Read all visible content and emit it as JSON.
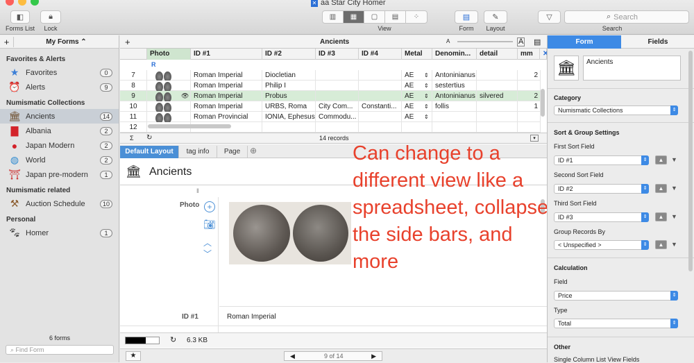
{
  "window": {
    "title": "aa Star City Homer"
  },
  "toolbar": {
    "forms_list": "Forms List",
    "lock": "Lock",
    "view": "View",
    "form": "Form",
    "layout": "Layout",
    "search_label": "Search",
    "search_placeholder": "Search"
  },
  "sidebar": {
    "header": "My Forms",
    "add": "+",
    "sections": [
      {
        "title": "Favorites & Alerts",
        "items": [
          {
            "label": "Favorites",
            "count": "0",
            "icon": "star-icon"
          },
          {
            "label": "Alerts",
            "count": "9",
            "icon": "alarm-icon"
          }
        ]
      },
      {
        "title": "Numismatic Collections",
        "items": [
          {
            "label": "Ancients",
            "count": "14",
            "icon": "temple-icon"
          },
          {
            "label": "Albania",
            "count": "2",
            "icon": "flag-albania-icon"
          },
          {
            "label": "Japan Modern",
            "count": "2",
            "icon": "flag-japan-icon"
          },
          {
            "label": "World",
            "count": "2",
            "icon": "globe-icon"
          },
          {
            "label": "Japan pre-modern",
            "count": "1",
            "icon": "torii-icon"
          }
        ]
      },
      {
        "title": "Numismatic related",
        "items": [
          {
            "label": "Auction Schedule",
            "count": "10",
            "icon": "gavel-icon"
          }
        ]
      },
      {
        "title": "Personal",
        "items": [
          {
            "label": "Homer",
            "count": "1",
            "icon": "paw-icon"
          }
        ]
      }
    ],
    "footer_count": "6 forms",
    "find_placeholder": "Find Form"
  },
  "grid": {
    "title": "Ancients",
    "add": "+",
    "columns": [
      "Photo",
      "ID #1",
      "ID #2",
      "ID #3",
      "ID #4",
      "Metal",
      "Denomin...",
      "detail",
      "mm"
    ],
    "group_label": "R",
    "rows": [
      {
        "n": "7",
        "id1": "Roman Imperial",
        "id2": "Diocletian",
        "id3": "",
        "id4": "",
        "metal": "AE",
        "denom": "Antoninianus",
        "detail": "",
        "mm": "2"
      },
      {
        "n": "8",
        "id1": "Roman Imperial",
        "id2": "Philip I",
        "id3": "",
        "id4": "",
        "metal": "AE",
        "denom": "sestertius",
        "detail": "",
        "mm": ""
      },
      {
        "n": "9",
        "id1": "Roman Imperial",
        "id2": "Probus",
        "id3": "",
        "id4": "",
        "metal": "AE",
        "denom": "Antoninianus",
        "detail": "silvered",
        "mm": "2"
      },
      {
        "n": "10",
        "id1": "Roman Imperial",
        "id2": "URBS, Roma",
        "id3": "City Com...",
        "id4": "Constanti...",
        "metal": "AE",
        "denom": "follis",
        "detail": "",
        "mm": "1"
      },
      {
        "n": "11",
        "id1": "Roman Provincial",
        "id2": "IONIA, Ephesus",
        "id3": "Commodu...",
        "id4": "",
        "metal": "AE",
        "denom": "",
        "detail": "",
        "mm": ""
      },
      {
        "n": "12",
        "id1": "",
        "id2": "",
        "id3": "",
        "id4": "",
        "metal": "",
        "denom": "",
        "detail": "",
        "mm": ""
      }
    ],
    "records": "14 records",
    "sigma": "Σ"
  },
  "detail": {
    "tabs": [
      "Default Layout",
      "tag info",
      "Page"
    ],
    "form_title": "Ancients",
    "photo_label": "Photo",
    "id1_label": "ID #1",
    "id1_value": "Roman Imperial",
    "file_size": "6.3 KB",
    "pager": "9 of 14"
  },
  "annotation": {
    "text": "Can change to a different view like a spreadsheet, collapse the side bars, and more"
  },
  "right_panel": {
    "tab_form": "Form",
    "tab_fields": "Fields",
    "form_name": "Ancients",
    "category_title": "Category",
    "category_value": "Numismatic Collections",
    "sort_title": "Sort & Group Settings",
    "first_sort_label": "First Sort Field",
    "first_sort": "ID #1",
    "second_sort_label": "Second Sort Field",
    "second_sort": "ID #2",
    "third_sort_label": "Third Sort Field",
    "third_sort": "ID #3",
    "group_label": "Group Records By",
    "group_value": "< Unspecified >",
    "calc_title": "Calculation",
    "field_label": "Field",
    "field_value": "Price",
    "type_label": "Type",
    "type_value": "Total",
    "other_title": "Other",
    "single_col": "Single Column List View Fields"
  },
  "colors": {
    "accent": "#3d8ae5",
    "annotation": "#e8412c",
    "selected_row": "#d7ecd7",
    "selected_sidebar": "#c9cfd6"
  }
}
